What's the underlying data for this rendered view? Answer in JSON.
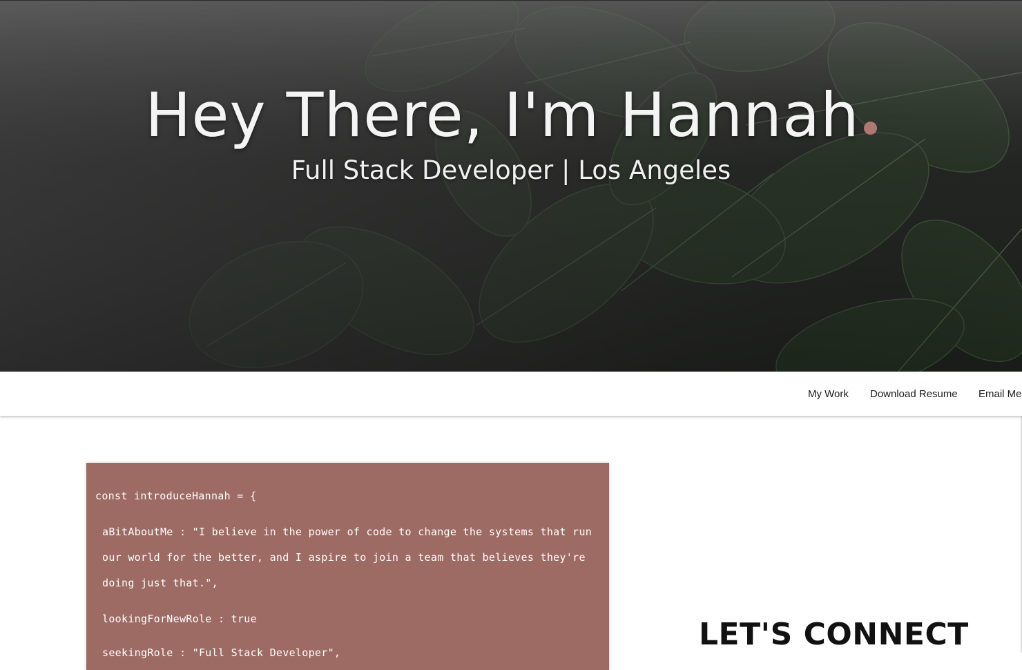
{
  "hero": {
    "title": "Hey There, I'm Hannah",
    "subtitle": "Full Stack Developer | Los Angeles",
    "accent_dot_color": "#b07874",
    "background": "dark green plant leaves photo"
  },
  "nav": {
    "links": [
      {
        "label": "My Work"
      },
      {
        "label": "Download Resume"
      },
      {
        "label": "Email Me"
      }
    ]
  },
  "code_card": {
    "background_color": "#9e6a64",
    "lines": [
      "const introduceHannah = {",
      "aBitAboutMe : \"I believe in the power of code to change the systems that run",
      "our world for the better, and I aspire to join a team that believes they're",
      "doing just that.\",",
      "lookingForNewRole : true",
      "seekingRole : \"Full Stack Developer\","
    ]
  },
  "connect": {
    "heading": "LET'S CONNECT"
  }
}
